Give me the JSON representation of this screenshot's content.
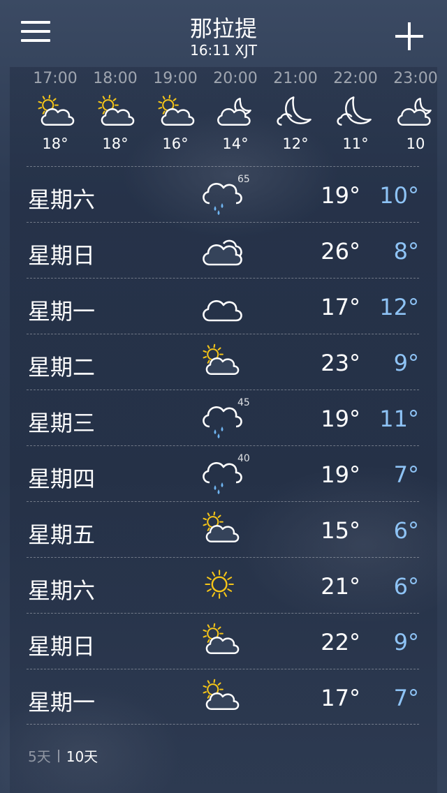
{
  "header": {
    "city": "那拉提",
    "time": "16:11 XJT",
    "menu_icon": "hamburger-menu-icon",
    "add_icon": "plus-icon"
  },
  "hourly": [
    {
      "time": "17:00",
      "icon": "partly-sunny",
      "temp": "18°"
    },
    {
      "time": "18:00",
      "icon": "partly-sunny",
      "temp": "18°"
    },
    {
      "time": "19:00",
      "icon": "partly-sunny",
      "temp": "16°"
    },
    {
      "time": "20:00",
      "icon": "partly-cloudy-night",
      "temp": "14°"
    },
    {
      "time": "21:00",
      "icon": "clear-night",
      "temp": "12°"
    },
    {
      "time": "22:00",
      "icon": "clear-night",
      "temp": "11°"
    },
    {
      "time": "23:00",
      "icon": "partly-cloudy-night",
      "temp": "10"
    }
  ],
  "daily": [
    {
      "day": "星期六",
      "icon": "rain",
      "precip": "65",
      "hi": "19°",
      "lo": "10°"
    },
    {
      "day": "星期日",
      "icon": "cloudy",
      "precip": "",
      "hi": "26°",
      "lo": "8°"
    },
    {
      "day": "星期一",
      "icon": "cloud",
      "precip": "",
      "hi": "17°",
      "lo": "12°"
    },
    {
      "day": "星期二",
      "icon": "partly-sunny",
      "precip": "",
      "hi": "23°",
      "lo": "9°"
    },
    {
      "day": "星期三",
      "icon": "rain",
      "precip": "45",
      "hi": "19°",
      "lo": "11°"
    },
    {
      "day": "星期四",
      "icon": "rain",
      "precip": "40",
      "hi": "19°",
      "lo": "7°"
    },
    {
      "day": "星期五",
      "icon": "partly-sunny",
      "precip": "",
      "hi": "15°",
      "lo": "6°"
    },
    {
      "day": "星期六",
      "icon": "sunny",
      "precip": "",
      "hi": "21°",
      "lo": "6°"
    },
    {
      "day": "星期日",
      "icon": "partly-sunny",
      "precip": "",
      "hi": "22°",
      "lo": "9°"
    },
    {
      "day": "星期一",
      "icon": "partly-sunny",
      "precip": "",
      "hi": "17°",
      "lo": "7°"
    }
  ],
  "footer": {
    "tab_5": "5天",
    "tab_10": "10天",
    "active_tab": "10天"
  },
  "colors": {
    "low_temp": "#8ec3f5",
    "sun": "#f5c518",
    "rain": "#6fb4f0"
  }
}
